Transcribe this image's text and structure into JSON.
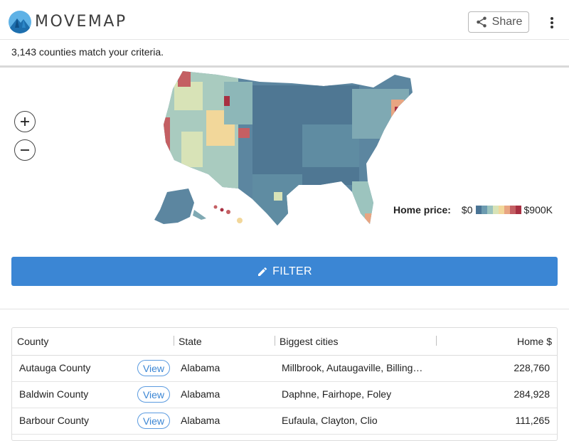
{
  "brand": {
    "name": "MOVEMAP"
  },
  "header": {
    "share_label": "Share",
    "share_icon": "share-icon",
    "menu_icon": "kebab-menu-icon"
  },
  "match": {
    "text": "3,143 counties match your criteria."
  },
  "map": {
    "zoom_in_icon": "plus-icon",
    "zoom_out_icon": "minus-icon",
    "legend": {
      "label": "Home price:",
      "min": "$0",
      "max": "$900K",
      "colors": [
        "#4a7495",
        "#6c9bb0",
        "#9cc4be",
        "#d8e3b7",
        "#f2d79a",
        "#e8a582",
        "#c45f63",
        "#a83042"
      ]
    }
  },
  "filter": {
    "label": "FILTER",
    "icon": "pencil-icon"
  },
  "table": {
    "headers": {
      "county": "County",
      "state": "State",
      "cities": "Biggest cities",
      "price": "Home $"
    },
    "view_label": "View",
    "rows": [
      {
        "county": "Autauga County",
        "state": "Alabama",
        "cities": "Millbrook, Autaugaville, Billing…",
        "price": "228,760"
      },
      {
        "county": "Baldwin County",
        "state": "Alabama",
        "cities": "Daphne, Fairhope, Foley",
        "price": "284,928"
      },
      {
        "county": "Barbour County",
        "state": "Alabama",
        "cities": "Eufaula, Clayton, Clio",
        "price": "111,265"
      }
    ]
  }
}
